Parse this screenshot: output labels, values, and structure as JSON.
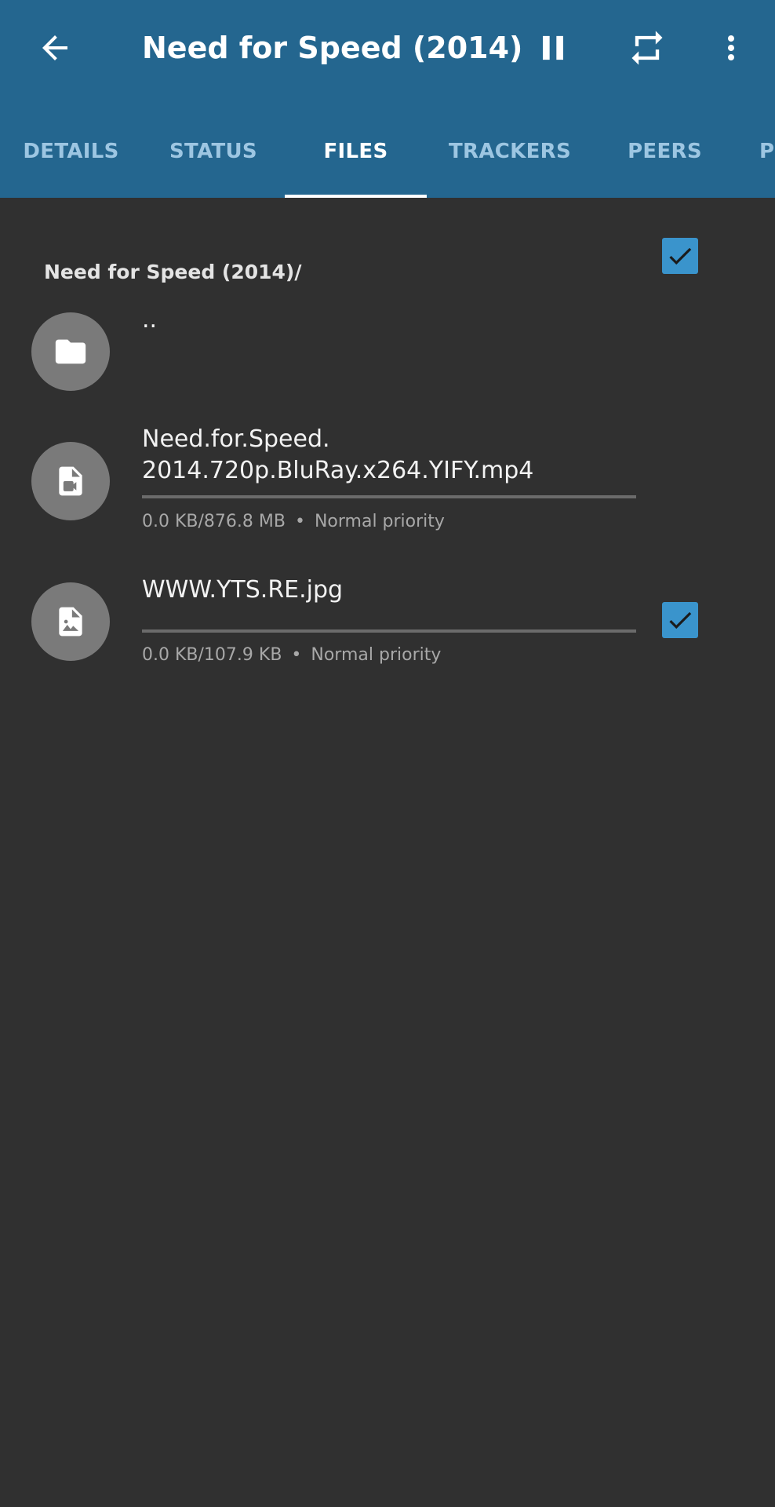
{
  "toolbar": {
    "title": "Need for Speed (2014)",
    "icons": {
      "back": "arrow-back-icon",
      "pause": "pause-icon",
      "repeat": "repeat-icon",
      "more": "more-vert-icon"
    }
  },
  "tabs": [
    {
      "label": "DETAILS",
      "active": false
    },
    {
      "label": "STATUS",
      "active": false
    },
    {
      "label": "FILES",
      "active": true
    },
    {
      "label": "TRACKERS",
      "active": false
    },
    {
      "label": "PEERS",
      "active": false
    },
    {
      "label": "P",
      "active": false
    }
  ],
  "files": {
    "path": "Need for Speed (2014)/",
    "parent": {
      "label": "..",
      "icon": "folder-icon"
    },
    "items": [
      {
        "name": "Need.for.Speed.\n2014.720p.BluRay.x264.YIFY.mp4",
        "size": "0.0 KB/876.8 MB",
        "separator": "•",
        "priority": "Normal priority",
        "progress": 0,
        "checked": true,
        "icon": "video-file-icon"
      },
      {
        "name": "WWW.YTS.RE.jpg",
        "size": "0.0 KB/107.9 KB",
        "separator": "•",
        "priority": "Normal priority",
        "progress": 0,
        "checked": true,
        "icon": "image-file-icon"
      }
    ]
  },
  "colors": {
    "appbar": "#24668f",
    "background": "#303030",
    "accent": "#3a94cc",
    "avatar": "#7a7a7a",
    "tab_inactive": "#9dc6e2"
  }
}
